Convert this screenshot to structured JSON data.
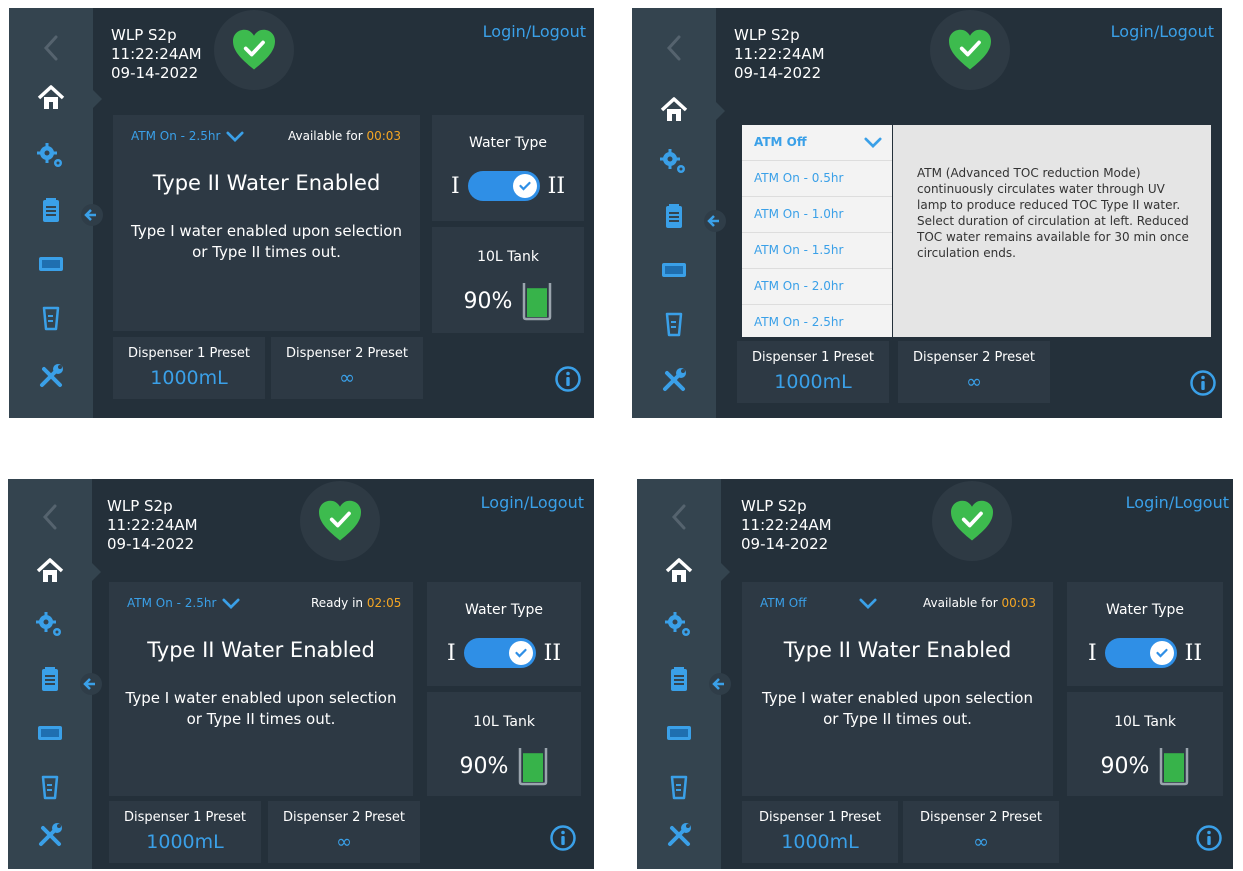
{
  "device": {
    "name": "WLP S2p",
    "time": "11:22:24AM",
    "date": "09-14-2022",
    "login_label": "Login/Logout",
    "status_icon": "heart-check-icon"
  },
  "colors": {
    "accent": "#3aa0e8",
    "timer": "#f5a623",
    "status": "#3dbb4e",
    "background": "#24303a",
    "sidebar": "#34444f"
  },
  "sidebar_icons": [
    "back-icon",
    "home-icon",
    "settings-gears-icon",
    "log-clipboard-icon",
    "dispenser-icon",
    "beaker-icon",
    "tools-icon"
  ],
  "screens": [
    {
      "atm_label": "ATM On - 2.5hr",
      "avail_prefix": "Available for",
      "avail_time": "00:03",
      "title": "Type II Water Enabled",
      "subtitle_line1": "Type I water enabled upon selection",
      "subtitle_line2": "or Type II times out.",
      "water_type_label": "Water Type",
      "type_one": "I",
      "type_two": "II",
      "tank_label": "10L Tank",
      "tank_percent": "90%",
      "tank_level": 0.9,
      "disp1_label": "Dispenser 1 Preset",
      "disp1_value": "1000mL",
      "disp2_label": "Dispenser 2 Preset",
      "disp2_value": "∞"
    },
    {
      "atm_options": [
        "ATM Off",
        "ATM On - 0.5hr",
        "ATM On - 1.0hr",
        "ATM On - 1.5hr",
        "ATM On - 2.0hr",
        "ATM On - 2.5hr"
      ],
      "atm_description": "ATM (Advanced TOC reduction Mode) continuously circulates water through UV lamp to produce reduced TOC Type II water. Select duration of circulation at left. Reduced TOC water remains available for 30 min once circulation ends.",
      "disp1_label": "Dispenser 1 Preset",
      "disp1_value": "1000mL",
      "disp2_label": "Dispenser 2 Preset",
      "disp2_value": "∞"
    },
    {
      "atm_label": "ATM On - 2.5hr",
      "avail_prefix": "Ready in",
      "avail_time": "02:05",
      "title": "Type II Water Enabled",
      "subtitle_line1": "Type I water enabled upon selection",
      "subtitle_line2": "or Type II times out.",
      "water_type_label": "Water Type",
      "type_one": "I",
      "type_two": "II",
      "tank_label": "10L Tank",
      "tank_percent": "90%",
      "tank_level": 0.9,
      "disp1_label": "Dispenser 1 Preset",
      "disp1_value": "1000mL",
      "disp2_label": "Dispenser 2 Preset",
      "disp2_value": "∞"
    },
    {
      "atm_label": "ATM Off",
      "avail_prefix": "Available for",
      "avail_time": "00:03",
      "title": "Type II Water Enabled",
      "subtitle_line1": "Type I water enabled upon selection",
      "subtitle_line2": "or Type II times out.",
      "water_type_label": "Water Type",
      "type_one": "I",
      "type_two": "II",
      "tank_label": "10L Tank",
      "tank_percent": "90%",
      "tank_level": 0.9,
      "disp1_label": "Dispenser 1 Preset",
      "disp1_value": "1000mL",
      "disp2_label": "Dispenser 2 Preset",
      "disp2_value": "∞"
    }
  ]
}
